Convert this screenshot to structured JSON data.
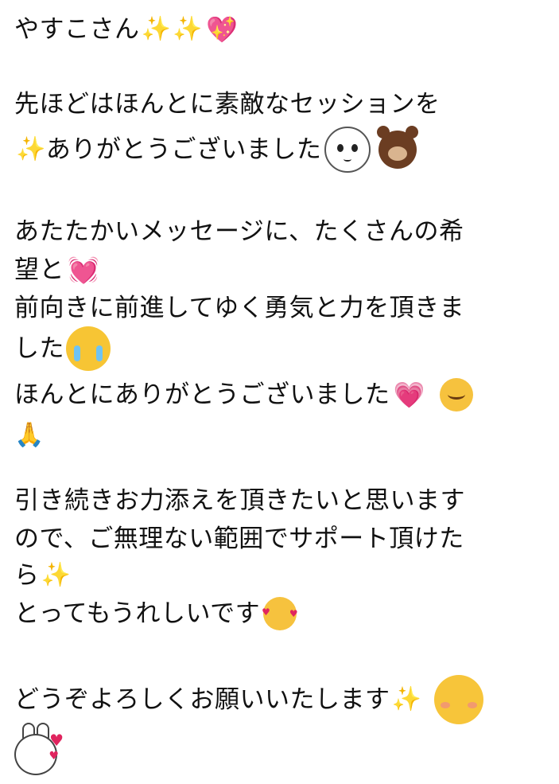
{
  "message": {
    "line1": "やすこさん",
    "line2": "先ほどはほんとに素敵なセッションを",
    "line3": "ありがとうございました",
    "line4": "あたたかいメッセージに、たくさんの希",
    "line5": "望と",
    "line6": "前向きに前進してゆく勇気と力を頂きま",
    "line7": "した",
    "line8": "ほんとにありがとうございました",
    "line9": "",
    "line10": "引き続きお力添えを頂きたいと思います",
    "line11": "ので、ご無理ない範囲でサポート頂けた",
    "line12": "ら",
    "line13": "とってもうれしいです",
    "line14": "どうぞよろしくお願いいたします"
  },
  "icons": {
    "sparkles": "sparkles-icon",
    "sparkling_heart": "sparkling-heart-icon",
    "pleading_face": "pleading-face-icon",
    "brown_bear": "brown-bear-icon",
    "heart_vibration": "heart-vibration-icon",
    "crying_face": "crying-face-icon",
    "pink_heart": "pink-heart-icon",
    "relieved_face": "relieved-face-icon",
    "folded_hands": "folded-hands-icon",
    "smiling_hearts_face": "smiling-face-with-hearts-icon",
    "sun_face": "sun-face-icon",
    "bunny_hearts": "bunny-hearts-icon"
  },
  "colors": {
    "text": "#111111",
    "background": "#ffffff",
    "sparkle": "#f2c94c",
    "heart": "#e83e8c"
  }
}
